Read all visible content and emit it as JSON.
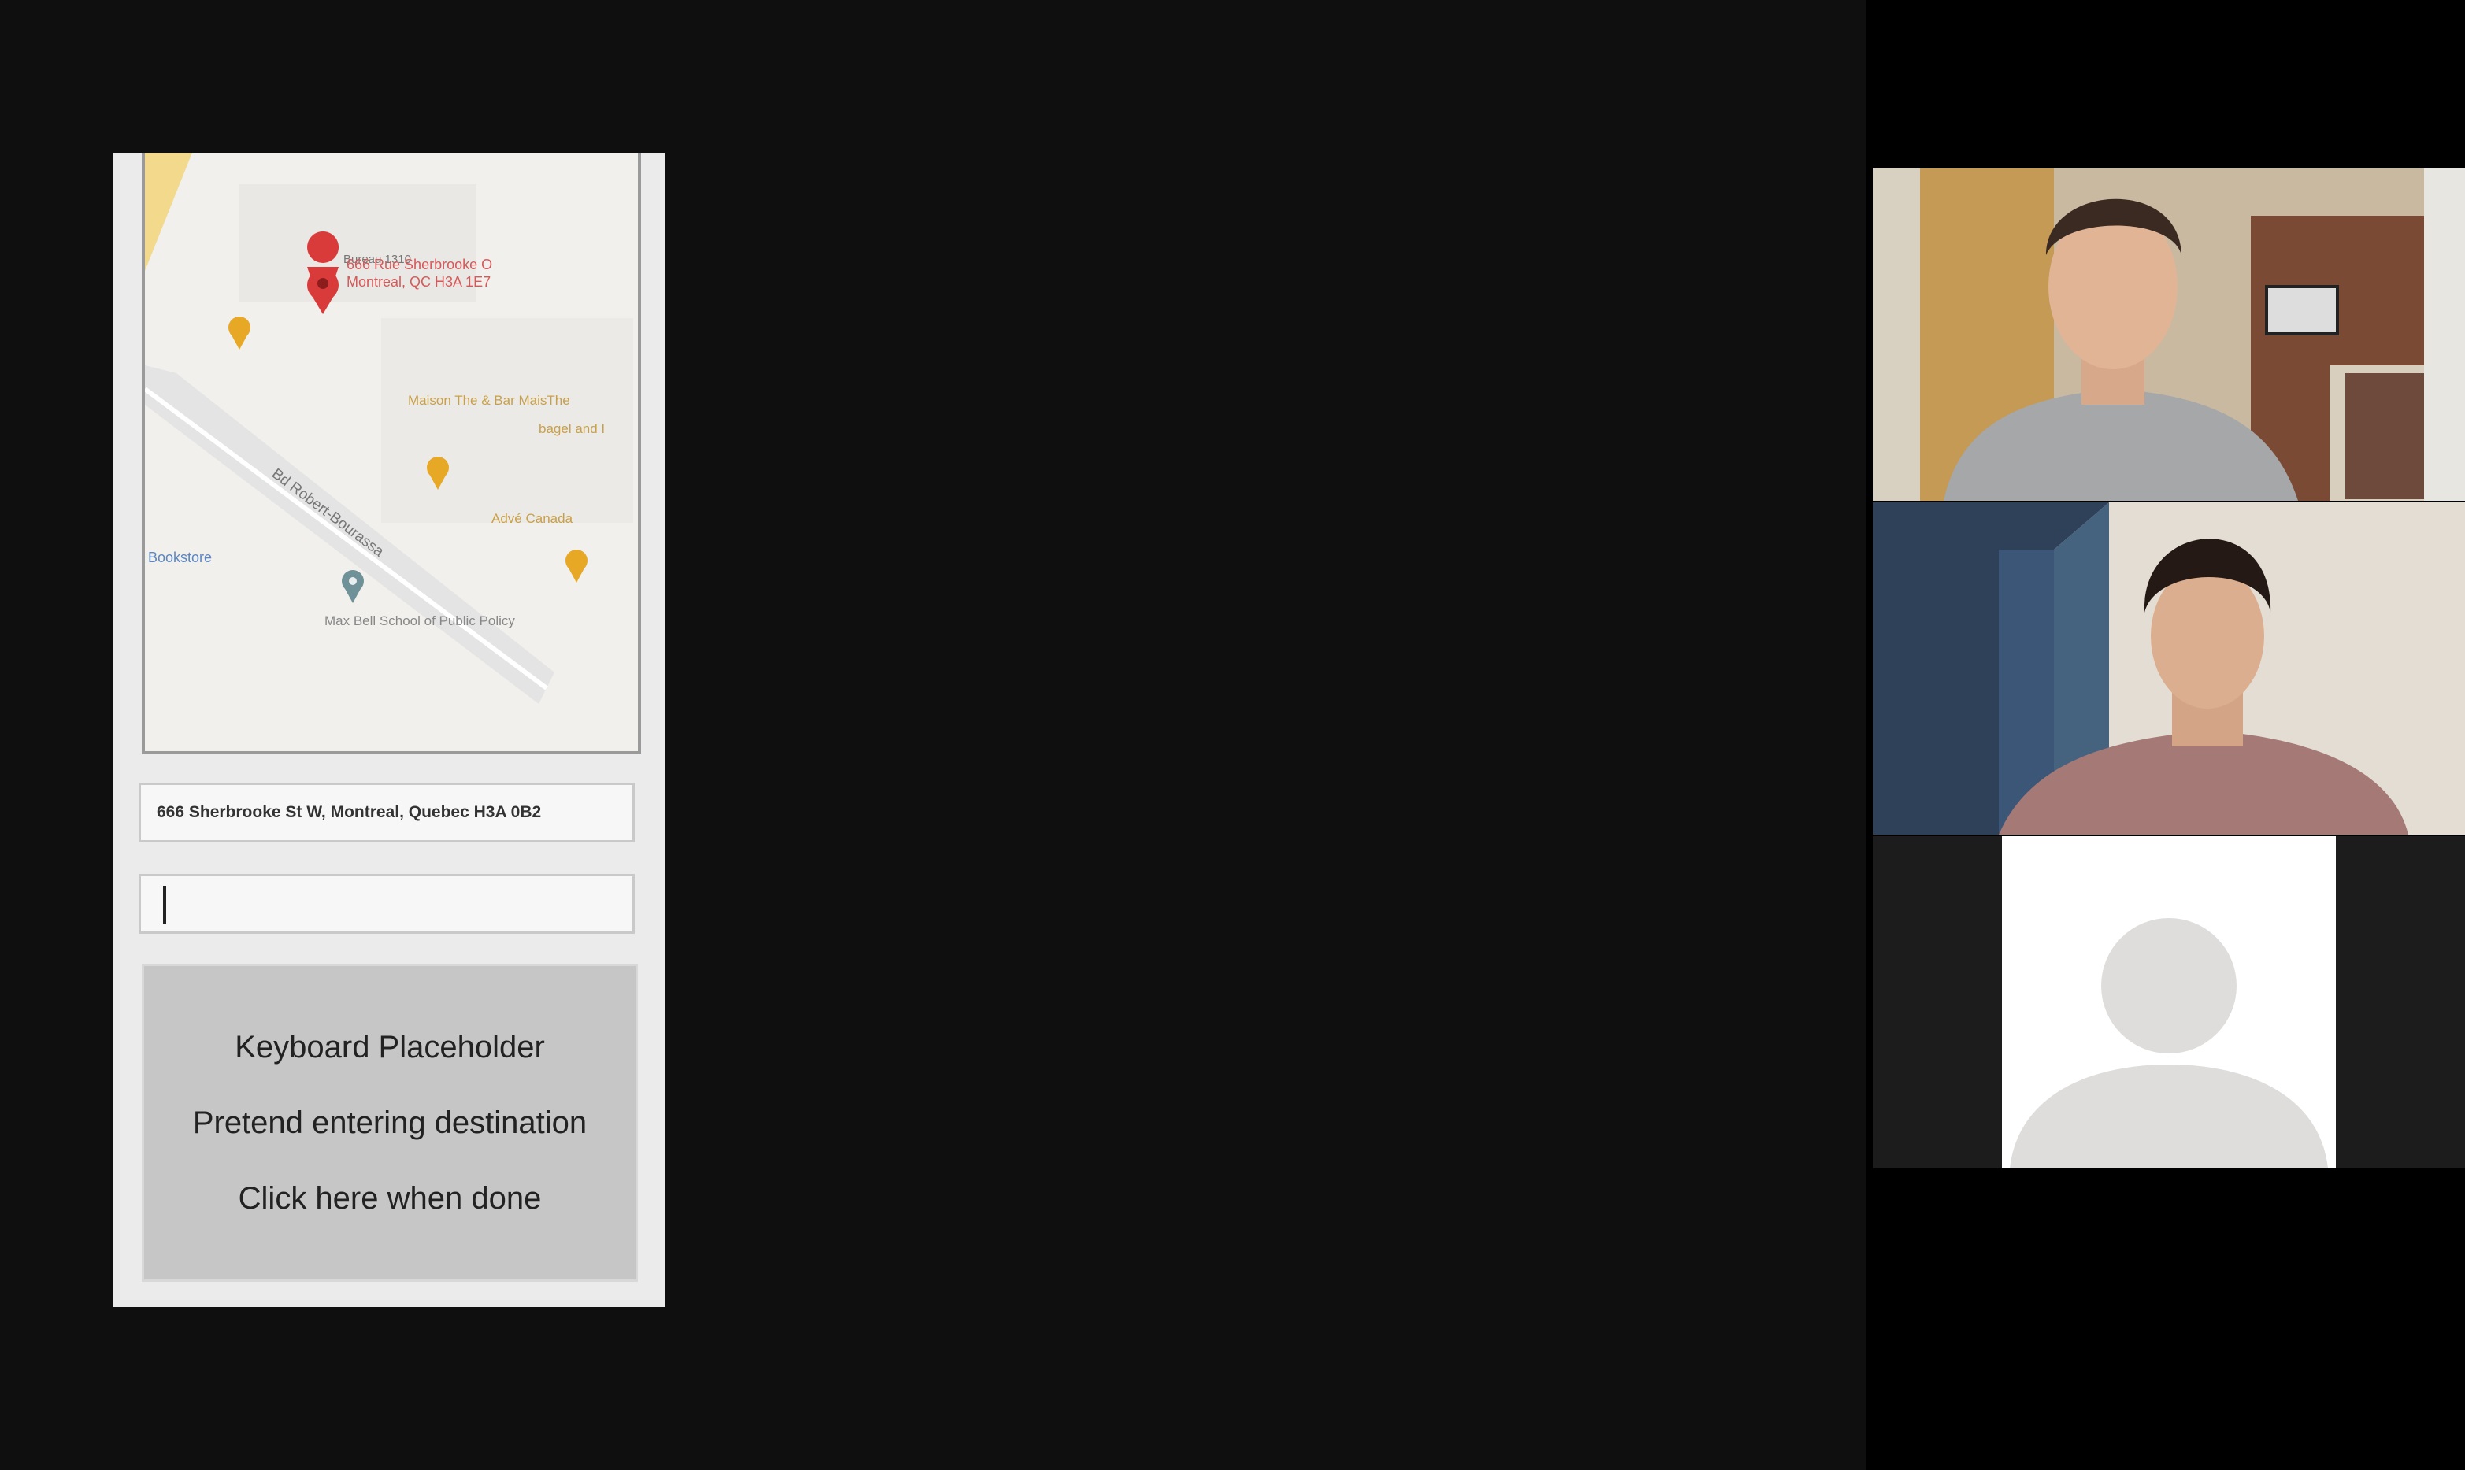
{
  "phone": {
    "map": {
      "selected_place_line1": "666 Rue Sherbrooke O",
      "selected_place_line2": "Montreal, QC H3A 1E7",
      "place_labels": [
        "Bureau 1310",
        "Maison The & Bar MaisThe",
        "bagel and I",
        "Advé Canada",
        "Max Bell School of Public Policy",
        "Bookstore"
      ],
      "street_label": "Bd Robert-Bourassa",
      "icons": [
        "red-location-pin-icon",
        "restaurant-pin-icon",
        "school-pin-icon"
      ]
    },
    "address_value": "666 Sherbrooke St W, Montreal, Quebec H3A 0B2",
    "destination_value": "",
    "keyboard": {
      "line1": "Keyboard Placeholder",
      "line2": "Pretend entering destination",
      "line3": "Click here when done"
    }
  },
  "gallery": {
    "participants": [
      {
        "type": "video",
        "description": "participant-1"
      },
      {
        "type": "video",
        "description": "participant-2"
      },
      {
        "type": "avatar",
        "icon": "default-avatar-icon"
      }
    ]
  },
  "colors": {
    "background": "#0f0f0f",
    "gallery_background": "#000000",
    "keyboard": "#c6c6c6",
    "map_pin": "#d93b3b",
    "restaurant_pin": "#e7a826"
  }
}
